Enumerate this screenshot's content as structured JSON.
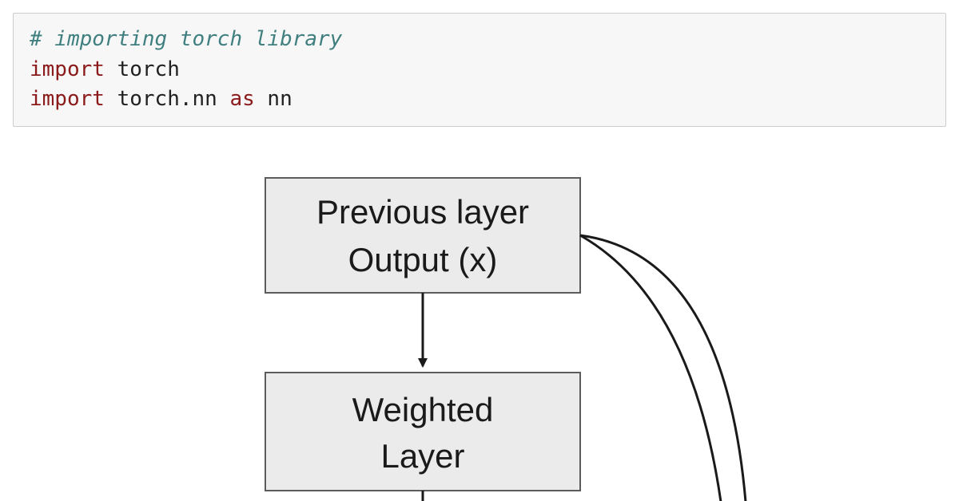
{
  "code": {
    "c1": "# importing torch library",
    "kw1": "import",
    "t1": " torch",
    "kw2": "import",
    "t2": " torch.nn ",
    "kw3": "as",
    "t3": " nn"
  },
  "diagram": {
    "node1_line1": "Previous layer",
    "node1_line2": "Output (x)",
    "node2_line1": "Weighted",
    "node2_line2": "Layer"
  }
}
